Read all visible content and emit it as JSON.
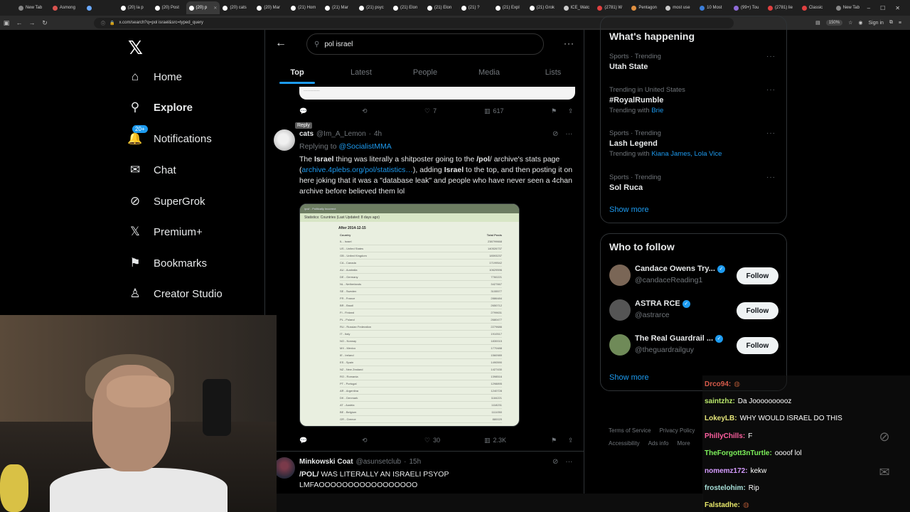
{
  "browser": {
    "tabs": [
      {
        "label": "New Tab",
        "color": "#888888"
      },
      {
        "label": "Asmong",
        "color": "#d9534f"
      },
      {
        "label": "",
        "color": "#6aa9ff"
      },
      {
        "label": "(20) la p",
        "color": "#ffffff"
      },
      {
        "label": "(20) Post",
        "color": "#ffffff"
      },
      {
        "label": "(20) p",
        "color": "#ffffff",
        "active": true
      },
      {
        "label": "(20) cats",
        "color": "#ffffff"
      },
      {
        "label": "(20) Mar",
        "color": "#ffffff"
      },
      {
        "label": "(21) Hom",
        "color": "#ffffff"
      },
      {
        "label": "(21) Mar",
        "color": "#ffffff"
      },
      {
        "label": "(21) psyc",
        "color": "#ffffff"
      },
      {
        "label": "(21) Elon",
        "color": "#ffffff"
      },
      {
        "label": "(21) Elon",
        "color": "#ffffff"
      },
      {
        "label": "(21) ?",
        "color": "#ffffff"
      },
      {
        "label": "(21) Expl",
        "color": "#ffffff"
      },
      {
        "label": "(21) Grok",
        "color": "#ffffff"
      },
      {
        "label": "ICE_Watc",
        "color": "#cccccc"
      },
      {
        "label": "(2781) W",
        "color": "#e04040"
      },
      {
        "label": "Pentagon",
        "color": "#e09040"
      },
      {
        "label": "most use",
        "color": "#cccccc"
      },
      {
        "label": "10 Most",
        "color": "#3b7dd8"
      },
      {
        "label": "(99+) Tou",
        "color": "#8f6bd8"
      },
      {
        "label": "(2781) lie",
        "color": "#e04040"
      },
      {
        "label": "Classic",
        "color": "#e04040"
      },
      {
        "label": "New Tab",
        "color": "#888888"
      }
    ],
    "url": "x.com/search?q=pol israel&src=typed_query",
    "zoom": "150%",
    "signin": "Sign in"
  },
  "sidebar": {
    "items": [
      {
        "label": "Home",
        "icon": "home-icon",
        "glyph": "⌂"
      },
      {
        "label": "Explore",
        "icon": "search-icon",
        "glyph": "⚲",
        "bold": true
      },
      {
        "label": "Notifications",
        "icon": "bell-icon",
        "glyph": "🔔",
        "badge": "20+"
      },
      {
        "label": "Chat",
        "icon": "mail-icon",
        "glyph": "✉"
      },
      {
        "label": "SuperGrok",
        "icon": "grok-icon",
        "glyph": "⊘"
      },
      {
        "label": "Premium+",
        "icon": "x-logo-icon",
        "glyph": "𝕏"
      },
      {
        "label": "Bookmarks",
        "icon": "bookmark-icon",
        "glyph": "⚑"
      },
      {
        "label": "Creator Studio",
        "icon": "creator-studio-icon",
        "glyph": "♙"
      }
    ]
  },
  "search": {
    "query": "pol israel",
    "tabs": [
      "Top",
      "Latest",
      "People",
      "Media",
      "Lists"
    ]
  },
  "prev_tweet": {
    "replies": "",
    "retweets": "",
    "likes": "7",
    "views": "617",
    "tooltip": "Reply"
  },
  "tweet1": {
    "name": "cats",
    "handle": "@Im_A_Lemon",
    "time": "4h",
    "replying_label": "Replying to",
    "replying_to": "@SocialistMMA",
    "text_parts": {
      "p1": "The ",
      "b1": "Israel",
      "p2": " thing was literally a shitposter going to the ",
      "b2": "/pol",
      "p3": "/ archive's stats page (",
      "link": "archive.4plebs.org/pol/statistics…",
      "p4": "), adding ",
      "b3": "Israel",
      "p5": " to the top, and then posting it on here joking that it was a \"database leak\" and people who have never seen a 4chan archive before believed them lol"
    },
    "image": {
      "site": "/pol/ - Politically Incorrect",
      "subheader": "Statistics: Countries (Last Updated: 8 days ago)",
      "title": "After 2014-12-15",
      "col_country": "Country",
      "col_posts": "Total Posts",
      "rows": [
        {
          "country": "IL - Israel",
          "posts": "238799668"
        },
        {
          "country": "US - United States",
          "posts": "140526737"
        },
        {
          "country": "GB - United Kingdom",
          "posts": "18593237"
        },
        {
          "country": "CA - Canada",
          "posts": "17199542"
        },
        {
          "country": "AU - Australia",
          "posts": "10629596"
        },
        {
          "country": "DE - Germany",
          "posts": "7760221"
        },
        {
          "country": "NL - Netherlands",
          "posts": "3427667"
        },
        {
          "country": "SE - Sweden",
          "posts": "3155577"
        },
        {
          "country": "FR - France",
          "posts": "2886484"
        },
        {
          "country": "BR - Brazil",
          "posts": "2650712"
        },
        {
          "country": "FI - Finland",
          "posts": "2799631"
        },
        {
          "country": "PL - Poland",
          "posts": "2680477"
        },
        {
          "country": "RU - Russian Federation",
          "posts": "2279686"
        },
        {
          "country": "IT - Italy",
          "posts": "1910517"
        },
        {
          "country": "NO - Norway",
          "posts": "1830015"
        },
        {
          "country": "MX - Mexico",
          "posts": "1770488"
        },
        {
          "country": "IE - Ireland",
          "posts": "1560989"
        },
        {
          "country": "ES - Spain",
          "posts": "1490590"
        },
        {
          "country": "NZ - New Zealand",
          "posts": "1427430"
        },
        {
          "country": "RO - Romania",
          "posts": "1398516"
        },
        {
          "country": "PT - Portugal",
          "posts": "1298895"
        },
        {
          "country": "AR - Argentina",
          "posts": "1240728"
        },
        {
          "country": "DK - Denmark",
          "posts": "1184221"
        },
        {
          "country": "AT - Austria",
          "posts": "1118231"
        },
        {
          "country": "BE - Belgium",
          "posts": "1111050"
        },
        {
          "country": "GR - Greece",
          "posts": "880029"
        }
      ]
    },
    "replies": "",
    "retweets": "",
    "likes": "30",
    "views": "2.3K"
  },
  "tweet2": {
    "name": "Minkowski Coat",
    "handle": "@asunsetclub",
    "time": "15h",
    "line1_bold": "/POL/",
    "line1_rest": " WAS LITERALLY AN ISRAELI PSYOP",
    "line2": "LMFAOOOOOOOOOOOOOOOOO"
  },
  "right": {
    "whats_happening": "What's happening",
    "trends": [
      {
        "meta": "Sports · Trending",
        "title": "Utah State",
        "with_label": "",
        "with": ""
      },
      {
        "meta": "Trending in United States",
        "title": "#RoyalRumble",
        "with_label": "Trending with",
        "with": "Brie"
      },
      {
        "meta": "Sports · Trending",
        "title": "Lash Legend",
        "with_label": "Trending with",
        "with": "Kiana James, Lola Vice"
      },
      {
        "meta": "Sports · Trending",
        "title": "Sol Ruca",
        "with_label": "",
        "with": ""
      }
    ],
    "show_more": "Show more",
    "who_to_follow": "Who to follow",
    "follow": [
      {
        "name": "Candace Owens Try...",
        "handle": "@candaceReading1",
        "btn": "Follow",
        "color": "#7a6656"
      },
      {
        "name": "ASTRA RCE",
        "handle": "@astrarce",
        "btn": "Follow",
        "color": "#555555"
      },
      {
        "name": "The Real Guardrail ...",
        "handle": "@theguardrailguy",
        "btn": "Follow",
        "color": "#6f8a58"
      }
    ],
    "footer": [
      "Terms of Service",
      "Privacy Policy",
      "Accessibility",
      "Ads info",
      "More"
    ]
  },
  "chat": [
    {
      "user": "Drco94:",
      "text": "",
      "color": "#d65a4a"
    },
    {
      "user": "saintzhz:",
      "text": "Da Joooooooooz",
      "color": "#b9e86b"
    },
    {
      "user": "LokeyLB:",
      "text": "WHY WOULD ISRAEL DO THIS",
      "color": "#e6e67a"
    },
    {
      "user": "PhillyChills:",
      "text": "F",
      "color": "#ff5fa0"
    },
    {
      "user": "TheForgott3nTurtle:",
      "text": "oooof lol",
      "color": "#7cf05a"
    },
    {
      "user": "nomemz172:",
      "text": "kekw",
      "color": "#d59cff"
    },
    {
      "user": "frostelohim:",
      "text": "Rip",
      "color": "#a8e0d9"
    },
    {
      "user": "Falstadhe:",
      "text": "",
      "color": "#e8e86a"
    }
  ]
}
